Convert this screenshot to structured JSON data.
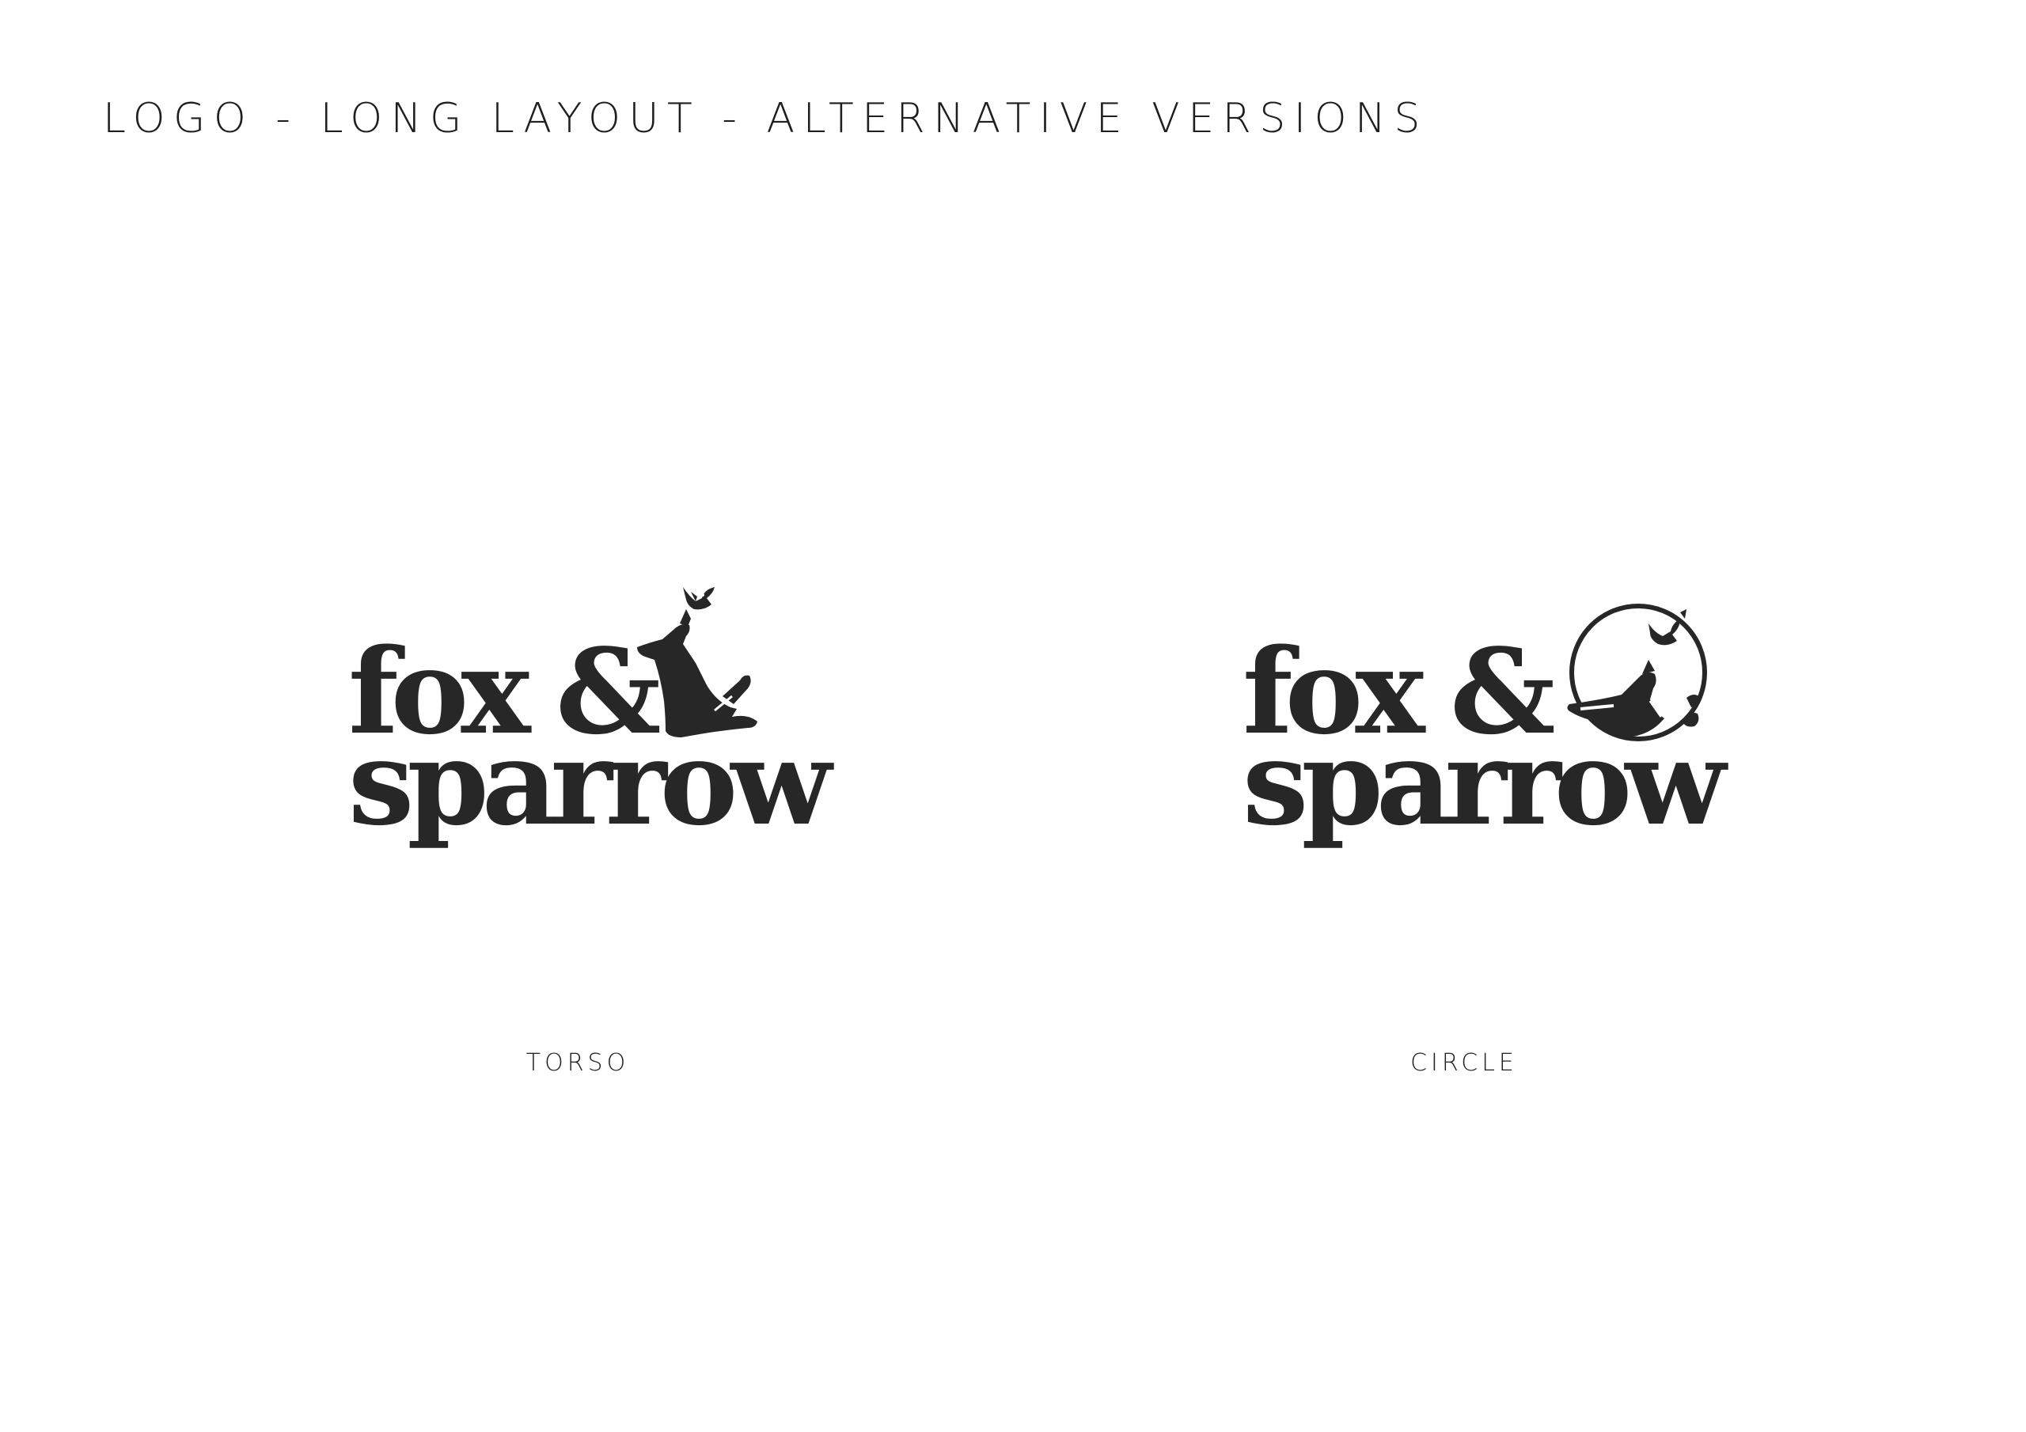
{
  "page": {
    "title": "LOGO - LONG LAYOUT - ALTERNATIVE VERSIONS"
  },
  "logos": [
    {
      "variant": "TORSO",
      "wordmark_line_1": "fox &",
      "wordmark_line_2": "sparrow",
      "emblem_icon": "fox-torso-with-sparrow-icon"
    },
    {
      "variant": "CIRCLE",
      "wordmark_line_1": "fox &",
      "wordmark_line_2": "sparrow",
      "emblem_icon": "fox-head-in-circle-with-sparrow-icon"
    }
  ],
  "colors": {
    "ink": "#272727",
    "background": "#ffffff"
  }
}
